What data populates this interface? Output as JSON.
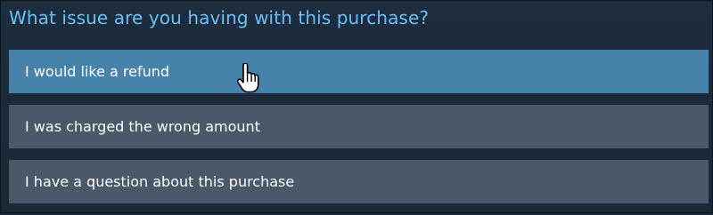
{
  "header": {
    "title": "What issue are you having with this purchase?"
  },
  "options": [
    {
      "label": "I would like a refund",
      "state": "hover"
    },
    {
      "label": "I was charged the wrong amount",
      "state": "default"
    },
    {
      "label": "I have a question about this purchase",
      "state": "default"
    }
  ],
  "cursor": {
    "icon": "hand-pointer-icon"
  },
  "colors": {
    "background": "#1b2838",
    "title": "#67c1f5",
    "option_default": "#4a5868",
    "option_hover": "#4782aa",
    "option_text": "#ffffff"
  }
}
